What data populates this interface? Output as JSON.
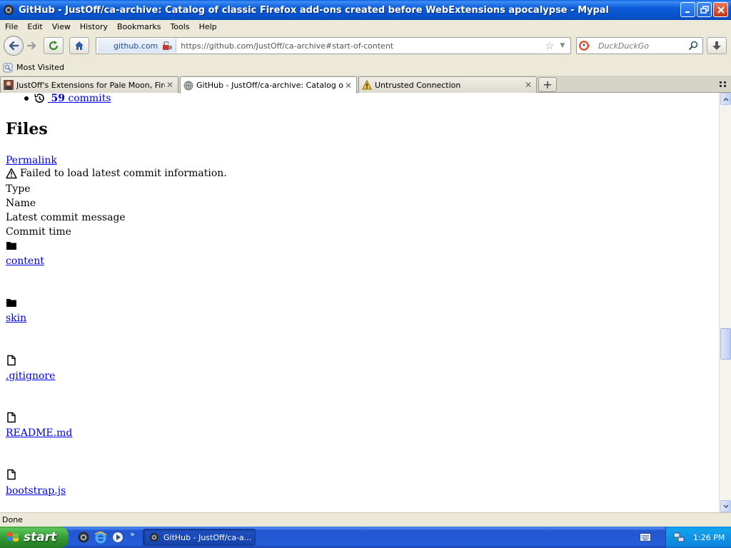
{
  "window": {
    "title": "GitHub - JustOff/ca-archive: Catalog of classic Firefox add-ons created before WebExtensions apocalypse - Mypal"
  },
  "menu": [
    "File",
    "Edit",
    "View",
    "History",
    "Bookmarks",
    "Tools",
    "Help"
  ],
  "navbar": {
    "identity_label": "github.com",
    "url": "https://github.com/JustOff/ca-archive#start-of-content",
    "search_placeholder": "DuckDuckGo"
  },
  "bookmarks": {
    "most_visited": "Most Visited"
  },
  "tabs": [
    {
      "label": "JustOff's Extensions for Pale Moon, Firef...",
      "icon": "avatar-favicon",
      "active": false
    },
    {
      "label": "GitHub - JustOff/ca-archive: Catalog of c...",
      "icon": "globe-favicon",
      "active": true
    },
    {
      "label": "Untrusted Connection",
      "icon": "warning-favicon",
      "active": false
    }
  ],
  "content": {
    "commits_count": "59",
    "commits_label": "commits",
    "files_heading": "Files",
    "permalink": "Permalink",
    "warning_text": "Failed to load latest commit information.",
    "headers": [
      "Type",
      "Name",
      "Latest commit message",
      "Commit time"
    ],
    "files": [
      {
        "name": "content",
        "type": "folder"
      },
      {
        "name": "skin",
        "type": "folder"
      },
      {
        "name": ".gitignore",
        "type": "file"
      },
      {
        "name": "README.md",
        "type": "file"
      },
      {
        "name": "bootstrap.js",
        "type": "file"
      }
    ]
  },
  "status": {
    "text": "Done"
  },
  "taskbar": {
    "start_label": "start",
    "task_label": "GitHub - JustOff/ca-a...",
    "clock": "1:26 PM"
  }
}
